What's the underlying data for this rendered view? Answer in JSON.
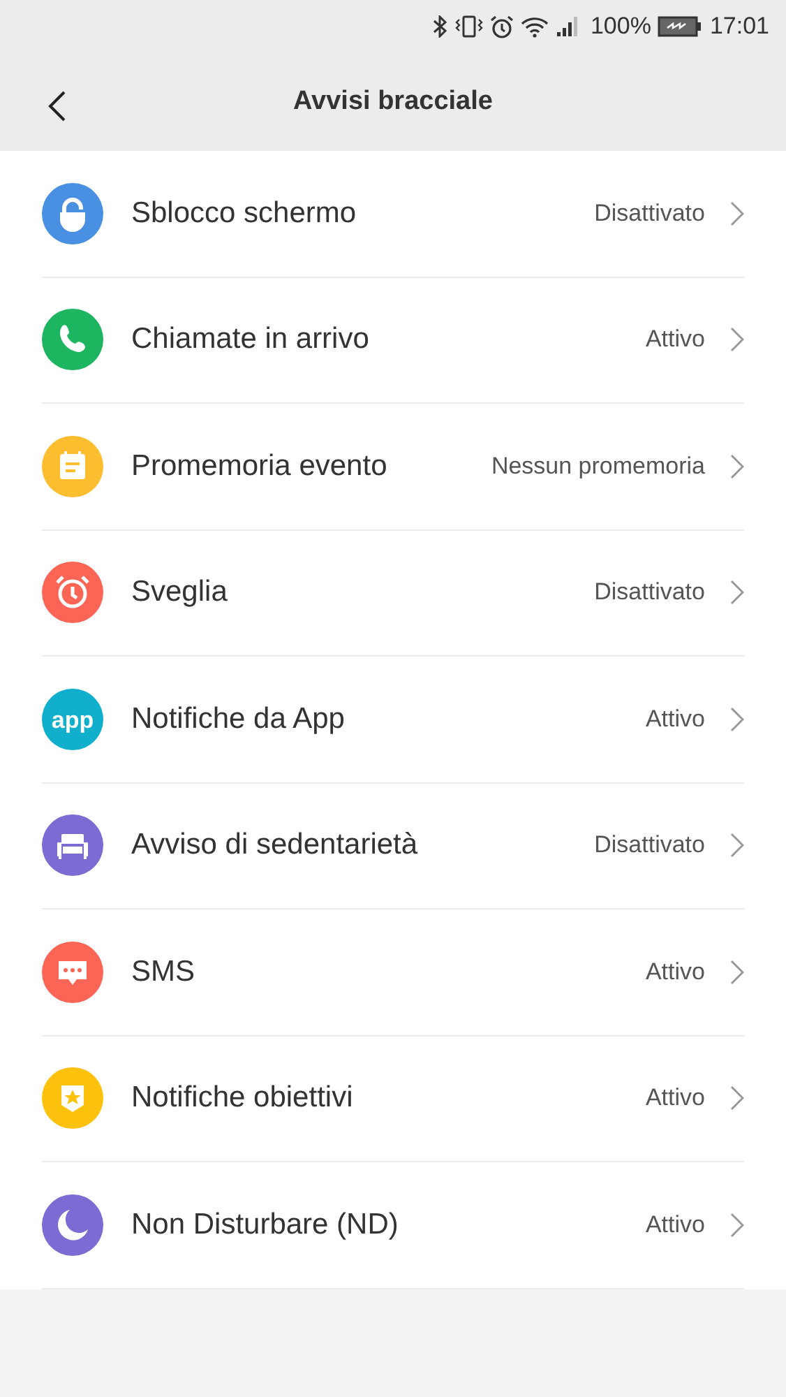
{
  "status_bar": {
    "battery_text": "100%",
    "time": "17:01"
  },
  "header": {
    "title": "Avvisi bracciale"
  },
  "items": [
    {
      "kind": "unlock",
      "color": "#4a90e2",
      "label": "Sblocco schermo",
      "value": "Disattivato"
    },
    {
      "kind": "phone",
      "color": "#1db560",
      "label": "Chiamate in arrivo",
      "value": "Attivo"
    },
    {
      "kind": "calendar",
      "color": "#fcbd2e",
      "label": "Promemoria evento",
      "value": "Nessun promemoria"
    },
    {
      "kind": "alarm",
      "color": "#fa6556",
      "label": "Sveglia",
      "value": "Disattivato"
    },
    {
      "kind": "app",
      "color": "#10afcb",
      "icon_text": "app",
      "label": "Notifiche da App",
      "value": "Attivo"
    },
    {
      "kind": "sofa",
      "color": "#7b6cd3",
      "label": "Avviso di sedentarietà",
      "value": "Disattivato"
    },
    {
      "kind": "sms",
      "color": "#fa6556",
      "label": "SMS",
      "value": "Attivo"
    },
    {
      "kind": "badge",
      "color": "#fcc10d",
      "label": "Notifiche obiettivi",
      "value": "Attivo"
    },
    {
      "kind": "moon",
      "color": "#7b6cd3",
      "label": "Non Disturbare (ND)",
      "value": "Attivo"
    }
  ]
}
